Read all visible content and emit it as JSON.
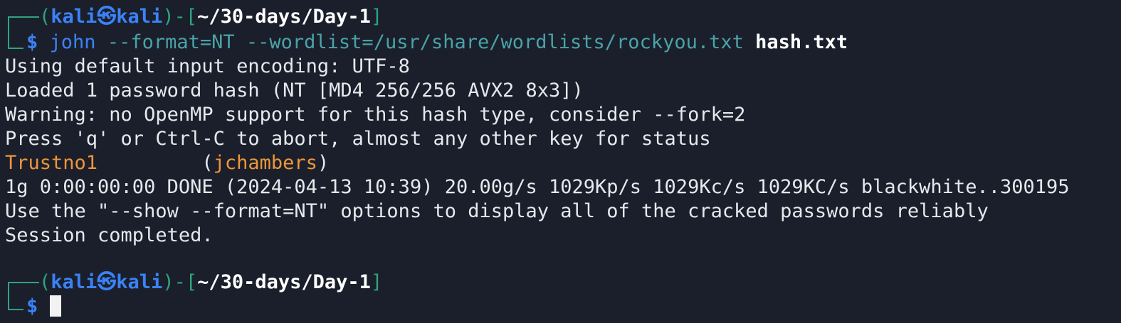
{
  "prompt1": {
    "open_paren": "(",
    "user": "kali",
    "at_icon": "kali-skull-icon",
    "host": "kali",
    "close_dash": ")-[",
    "path": "~/30-days/Day-1",
    "close_bracket": "]",
    "dollar": "$"
  },
  "command": {
    "program": "john",
    "args": " --format=NT --wordlist=/usr/share/wordlists/rockyou.txt ",
    "file": "hash.txt"
  },
  "output": {
    "lines": [
      "Using default input encoding: UTF-8",
      "Loaded 1 password hash (NT [MD4 256/256 AVX2 8x3])",
      "Warning: no OpenMP support for this hash type, consider --fork=2",
      "Press 'q' or Ctrl-C to abort, almost any other key for status"
    ],
    "cracked_password": "Trustno1",
    "cracked_spacing": "         ",
    "cracked_open": "(",
    "cracked_user": "jchambers",
    "cracked_close": ")",
    "status_line": "1g 0:00:00:00 DONE (2024-04-13 10:39) 20.00g/s 1029Kp/s 1029Kc/s 1029KC/s blackwhite..300195",
    "show_line": "Use the \"--show --format=NT\" options to display all of the cracked passwords reliably",
    "session_line": "Session completed."
  },
  "prompt2": {
    "open_paren": "(",
    "user": "kali",
    "at_icon": "kali-skull-icon",
    "host": "kali",
    "close_dash": ")-[",
    "path": "~/30-days/Day-1",
    "close_bracket": "]",
    "dollar": "$"
  },
  "colors": {
    "background": "#1a1f2b",
    "prompt_frame": "#2fa37e",
    "prompt_user": "#3b82f6",
    "command_args": "#4aa3a8",
    "highlight": "#f0963a",
    "text": "#e6e8ec"
  }
}
